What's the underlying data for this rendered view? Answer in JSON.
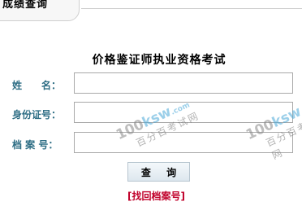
{
  "header": {
    "tab_title": "成绩查询"
  },
  "form": {
    "title": "价格鉴证师执业资格考试",
    "fields": [
      {
        "label": "姓　　名：",
        "value": ""
      },
      {
        "label": "身份证号：",
        "value": ""
      },
      {
        "label": "档 案 号：",
        "value": ""
      }
    ],
    "submit_label": "查 询",
    "recover_link": "[找回档案号]"
  },
  "watermark": {
    "logo_prefix": "100",
    "logo_suffix": "ksw",
    "logo_domain": ".com",
    "subtext": "百分百考试网"
  },
  "colors": {
    "label": "#2d6d84",
    "link": "#c0002a",
    "watermark_accent": "#4aa8d8"
  }
}
